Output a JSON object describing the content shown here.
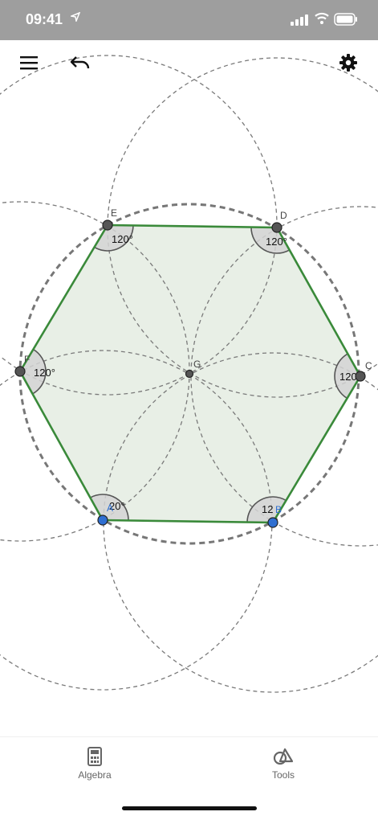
{
  "status_bar": {
    "time": "09:41"
  },
  "toolbar": {
    "menu_icon": "hamburger-icon",
    "undo_icon": "undo-icon",
    "settings_icon": "gear-icon"
  },
  "construction": {
    "points": [
      {
        "id": "A",
        "label": "A",
        "color": "#2f6fd1"
      },
      {
        "id": "B",
        "label": "B",
        "color": "#2f6fd1"
      },
      {
        "id": "C",
        "label": "C",
        "color": "#555555"
      },
      {
        "id": "D",
        "label": "D",
        "color": "#555555"
      },
      {
        "id": "E",
        "label": "E",
        "color": "#555555"
      },
      {
        "id": "F",
        "label": "F",
        "color": "#555555"
      },
      {
        "id": "G",
        "label": "G",
        "color": "#555555"
      }
    ],
    "angle_labels": [
      {
        "vertex": "A",
        "text": "20°"
      },
      {
        "vertex": "B",
        "text": "12"
      },
      {
        "vertex": "C",
        "text": "120"
      },
      {
        "vertex": "D",
        "text": "120°"
      },
      {
        "vertex": "E",
        "text": "120°"
      },
      {
        "vertex": "F",
        "text": "120°"
      }
    ],
    "polygon_color": "#3a8a3a",
    "polygon_fill": "#e8efe6"
  },
  "tabs": [
    {
      "label": "Algebra",
      "icon": "calculator-icon"
    },
    {
      "label": "Tools",
      "icon": "tools-icon"
    }
  ]
}
